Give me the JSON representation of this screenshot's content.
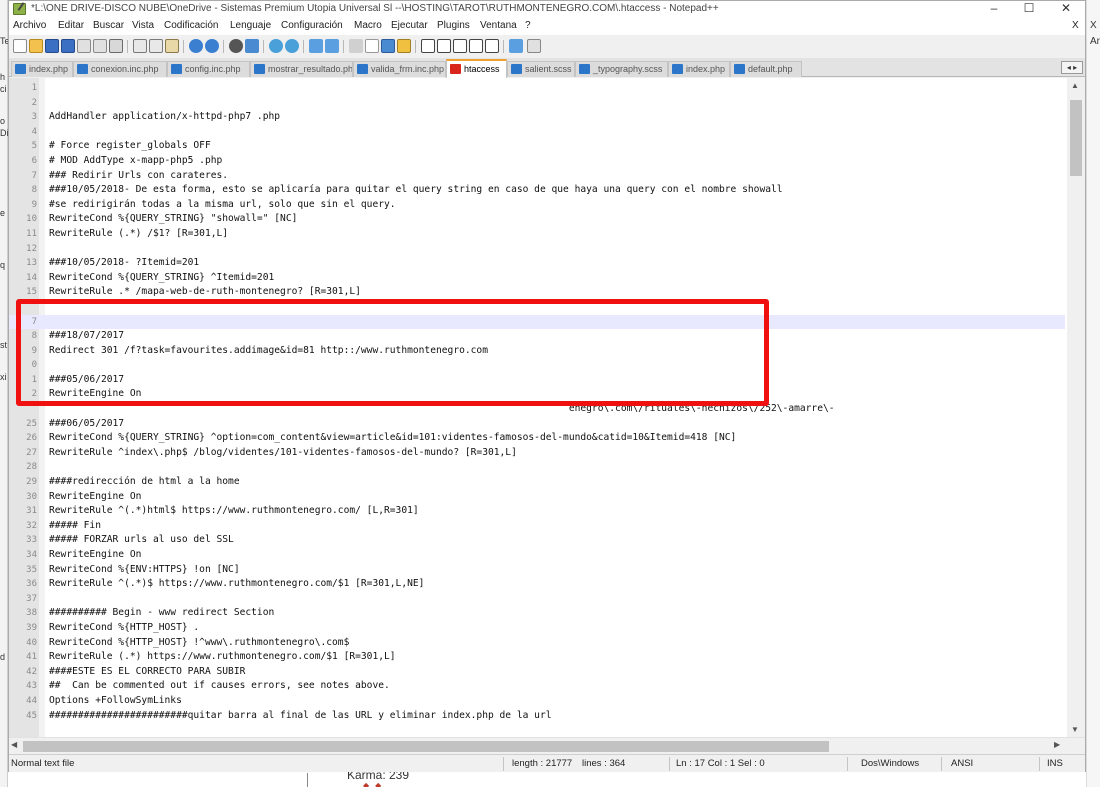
{
  "window": {
    "title": "*L:\\ONE DRIVE-DISCO NUBE\\OneDrive - Sistemas Premium Utopia Universal Sl --\\HOSTING\\TAROT\\RUTHMONTENEGRO.COM\\.htaccess - Notepad++",
    "controls": {
      "minimize": "–",
      "maximize": "☐",
      "close": "✕"
    }
  },
  "menu": {
    "items": [
      "Archivo",
      "Editar",
      "Buscar",
      "Vista",
      "Codificación",
      "Lenguaje",
      "Configuración",
      "Macro",
      "Ejecutar",
      "Plugins",
      "Ventana",
      "?"
    ],
    "close": "X"
  },
  "toolbar": {
    "icons": [
      "new-file-icon",
      "open-file-icon",
      "save-icon",
      "save-all-icon",
      "close-icon",
      "close-all-icon",
      "print-icon",
      "cut-icon",
      "copy-icon",
      "paste-icon",
      "undo-icon",
      "redo-icon",
      "find-icon",
      "replace-icon",
      "zoom-in-icon",
      "zoom-out-icon",
      "sync-vertical-icon",
      "sync-horizontal-icon",
      "word-wrap-icon",
      "all-chars-icon",
      "indent-guide-icon",
      "doc-map-icon",
      "record-macro-icon",
      "stop-macro-icon",
      "play-macro-icon",
      "run-macro-multiple-icon",
      "save-macro-icon",
      "launch-browser-icon",
      "spellcheck-icon"
    ]
  },
  "tabs": [
    {
      "label": "index.php",
      "active": false
    },
    {
      "label": "conexion.inc.php",
      "active": false
    },
    {
      "label": "config.inc.php",
      "active": false
    },
    {
      "label": "mostrar_resultado.php",
      "active": false
    },
    {
      "label": "valida_frm.inc.php",
      "active": false
    },
    {
      "label": "htaccess",
      "active": true
    },
    {
      "label": "salient.scss",
      "active": false
    },
    {
      "label": "_typography.scss",
      "active": false
    },
    {
      "label": "index.php",
      "active": false
    },
    {
      "label": "default.php",
      "active": false
    }
  ],
  "tab_scroll": "◂ ▸",
  "editor": {
    "lines": [
      {
        "n": "1",
        "text": ""
      },
      {
        "n": "2",
        "text": ""
      },
      {
        "n": "3",
        "text": "AddHandler application/x-httpd-php7 .php"
      },
      {
        "n": "4",
        "text": ""
      },
      {
        "n": "5",
        "text": "# Force register_globals OFF"
      },
      {
        "n": "6",
        "text": "# MOD AddType x-mapp-php5 .php"
      },
      {
        "n": "7",
        "text": "### Redirir Urls con carateres."
      },
      {
        "n": "8",
        "text": "###10/05/2018- De esta forma, esto se aplicaría para quitar el query string en caso de que haya una query con el nombre showall"
      },
      {
        "n": "9",
        "text": "#se redirigirán todas a la misma url, solo que sin el query."
      },
      {
        "n": "10",
        "text": "RewriteCond %{QUERY_STRING} \"showall=\" [NC]"
      },
      {
        "n": "11",
        "text": "RewriteRule (.*) /$1? [R=301,L]"
      },
      {
        "n": "12",
        "text": ""
      },
      {
        "n": "13",
        "text": "###10/05/2018- ?Itemid=201"
      },
      {
        "n": "14",
        "text": "RewriteCond %{QUERY_STRING} ^Itemid=201"
      },
      {
        "n": "15",
        "text": "RewriteRule .* /mapa-web-de-ruth-montenegro? [R=301,L]"
      },
      {
        "n": "",
        "text": ""
      },
      {
        "n": "7",
        "text": ""
      },
      {
        "n": "8",
        "text": "###18/07/2017"
      },
      {
        "n": "9",
        "text": "Redirect 301 /f?task=favourites.addimage&id=81 http::/www.ruthmontenegro.com"
      },
      {
        "n": "0",
        "text": ""
      },
      {
        "n": "1",
        "text": "###05/06/2017"
      },
      {
        "n": "2",
        "text": "RewriteEngine On"
      },
      {
        "n": "",
        "text": "                                                                                          enegro\\.com\\/rituales\\-hechizos\\/252\\-amarre\\-"
      },
      {
        "n": "25",
        "text": "###06/05/2017"
      },
      {
        "n": "26",
        "text": "RewriteCond %{QUERY_STRING} ^option=com_content&view=article&id=101:videntes-famosos-del-mundo&catid=10&Itemid=418 [NC]"
      },
      {
        "n": "27",
        "text": "RewriteRule ^index\\.php$ /blog/videntes/101-videntes-famosos-del-mundo? [R=301,L]"
      },
      {
        "n": "28",
        "text": ""
      },
      {
        "n": "29",
        "text": "####redirección de html a la home"
      },
      {
        "n": "30",
        "text": "RewriteEngine On"
      },
      {
        "n": "31",
        "text": "RewriteRule ^(.*)html$ https://www.ruthmontenegro.com/ [L,R=301]"
      },
      {
        "n": "32",
        "text": "##### Fin"
      },
      {
        "n": "33",
        "text": "##### FORZAR urls al uso del SSL"
      },
      {
        "n": "34",
        "text": "RewriteEngine On"
      },
      {
        "n": "35",
        "text": "RewriteCond %{ENV:HTTPS} !on [NC]"
      },
      {
        "n": "36",
        "text": "RewriteRule ^(.*)$ https://www.ruthmontenegro.com/$1 [R=301,L,NE]"
      },
      {
        "n": "37",
        "text": ""
      },
      {
        "n": "38",
        "text": "########## Begin - www redirect Section"
      },
      {
        "n": "39",
        "text": "RewriteCond %{HTTP_HOST} ."
      },
      {
        "n": "40",
        "text": "RewriteCond %{HTTP_HOST} !^www\\.ruthmontenegro\\.com$"
      },
      {
        "n": "41",
        "text": "RewriteRule (.*) https://www.ruthmontenegro.com/$1 [R=301,L]"
      },
      {
        "n": "42",
        "text": "####ESTE ES EL CORRECTO PARA SUBIR"
      },
      {
        "n": "43",
        "text": "##  Can be commented out if causes errors, see notes above."
      },
      {
        "n": "44",
        "text": "Options +FollowSymLinks"
      },
      {
        "n": "45",
        "text": "########################quitar barra al final de las URL y eliminar index.php de la url"
      }
    ],
    "current_line_index": 16
  },
  "statusbar": {
    "file_type": "Normal text file",
    "length": "length : 21777",
    "lines": "lines : 364",
    "position": "Ln : 17   Col : 1   Sel : 0",
    "eol": "Dos\\Windows",
    "encoding": "ANSI",
    "mode": "INS"
  },
  "background": {
    "karma": "Karma: 239",
    "left_strip": [
      "Te",
      "h",
      "ci",
      "o",
      "Di",
      "e",
      "q",
      "st",
      "xi",
      "d"
    ],
    "right_strip": [
      "X",
      "Ar"
    ]
  },
  "colors": {
    "highlight_border": "#f01010",
    "active_tab_accent": "#f0a030",
    "current_line": "#e8e8ff"
  }
}
